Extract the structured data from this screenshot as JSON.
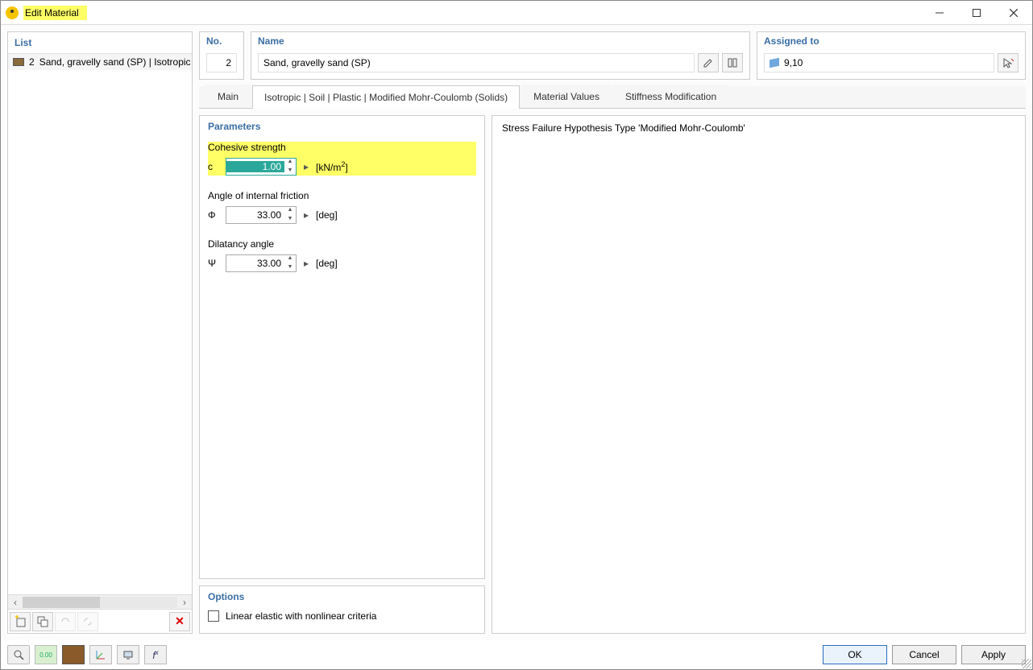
{
  "window": {
    "title": "Edit Material"
  },
  "list": {
    "header": "List",
    "items": [
      {
        "num": "2",
        "text": "Sand, gravelly sand (SP) | Isotropic | S"
      }
    ]
  },
  "top": {
    "no_label": "No.",
    "no_value": "2",
    "name_label": "Name",
    "name_value": "Sand, gravelly sand (SP)",
    "assigned_label": "Assigned to",
    "assigned_value": "9,10"
  },
  "tabs": {
    "main": "Main",
    "isotropic": "Isotropic | Soil | Plastic | Modified Mohr-Coulomb (Solids)",
    "material_values": "Material Values",
    "stiffness": "Stiffness Modification"
  },
  "params": {
    "title": "Parameters",
    "cohesive": {
      "label": "Cohesive strength",
      "symbol": "c",
      "value": "1.00",
      "unit": "[kN/m²]"
    },
    "friction": {
      "label": "Angle of internal friction",
      "symbol": "Φ",
      "value": "33.00",
      "unit": "[deg]"
    },
    "dilatancy": {
      "label": "Dilatancy angle",
      "symbol": "Ψ",
      "value": "33.00",
      "unit": "[deg]"
    }
  },
  "options": {
    "title": "Options",
    "linear_elastic": "Linear elastic with nonlinear criteria"
  },
  "right_info": "Stress Failure Hypothesis Type 'Modified Mohr-Coulomb'",
  "footer": {
    "ok": "OK",
    "cancel": "Cancel",
    "apply": "Apply"
  }
}
